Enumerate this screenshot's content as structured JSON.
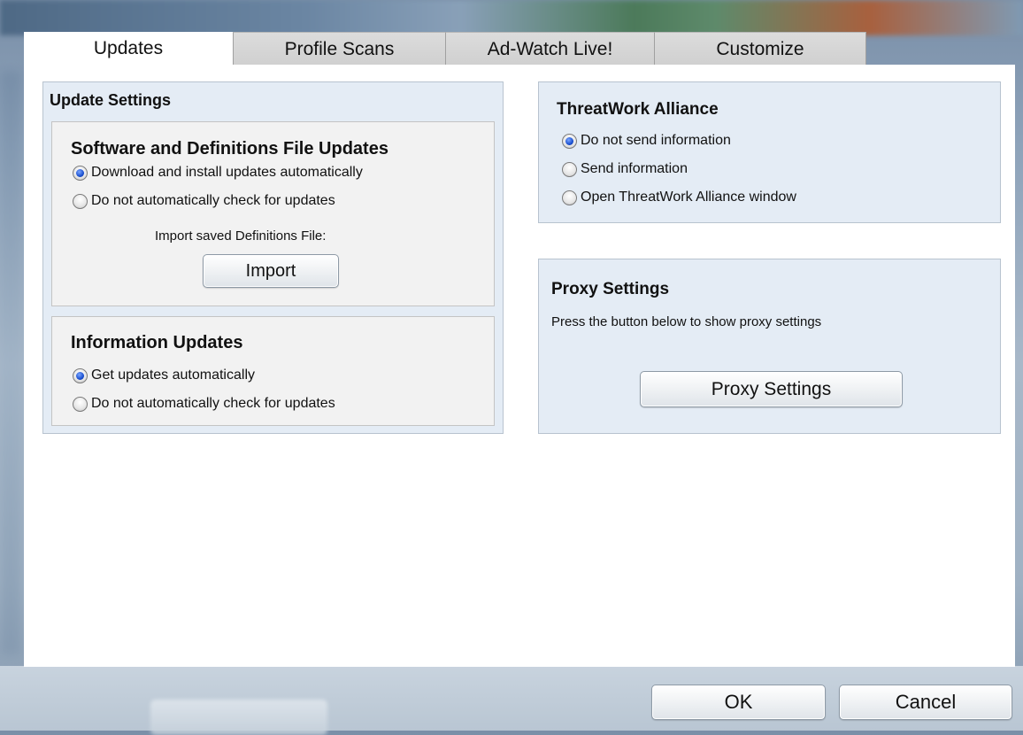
{
  "tabs": [
    {
      "label": "Updates",
      "active": true
    },
    {
      "label": "Profile Scans",
      "active": false
    },
    {
      "label": "Ad-Watch Live!",
      "active": false
    },
    {
      "label": "Customize",
      "active": false
    }
  ],
  "update_settings": {
    "title": "Update Settings",
    "software": {
      "title": "Software and Definitions File Updates",
      "options": [
        {
          "label": "Download and install updates automatically",
          "checked": true
        },
        {
          "label": "Do not automatically check for updates",
          "checked": false
        }
      ],
      "import_label": "Import saved Definitions File:",
      "import_button": "Import"
    },
    "information": {
      "title": "Information Updates",
      "options": [
        {
          "label": "Get updates automatically",
          "checked": true
        },
        {
          "label": "Do not automatically check for updates",
          "checked": false
        }
      ]
    }
  },
  "threatwork": {
    "title": "ThreatWork Alliance",
    "options": [
      {
        "label": "Do not send information",
        "checked": true
      },
      {
        "label": "Send information",
        "checked": false
      },
      {
        "label": "Open ThreatWork Alliance window",
        "checked": false
      }
    ]
  },
  "proxy": {
    "title": "Proxy Settings",
    "description": "Press the button below to show proxy settings",
    "button": "Proxy Settings"
  },
  "footer": {
    "ok": "OK",
    "cancel": "Cancel"
  },
  "colors": {
    "panel_blue": "#e4ecf5",
    "panel_grey": "#f2f2f2",
    "radio_checked": "#1a4fd0"
  }
}
